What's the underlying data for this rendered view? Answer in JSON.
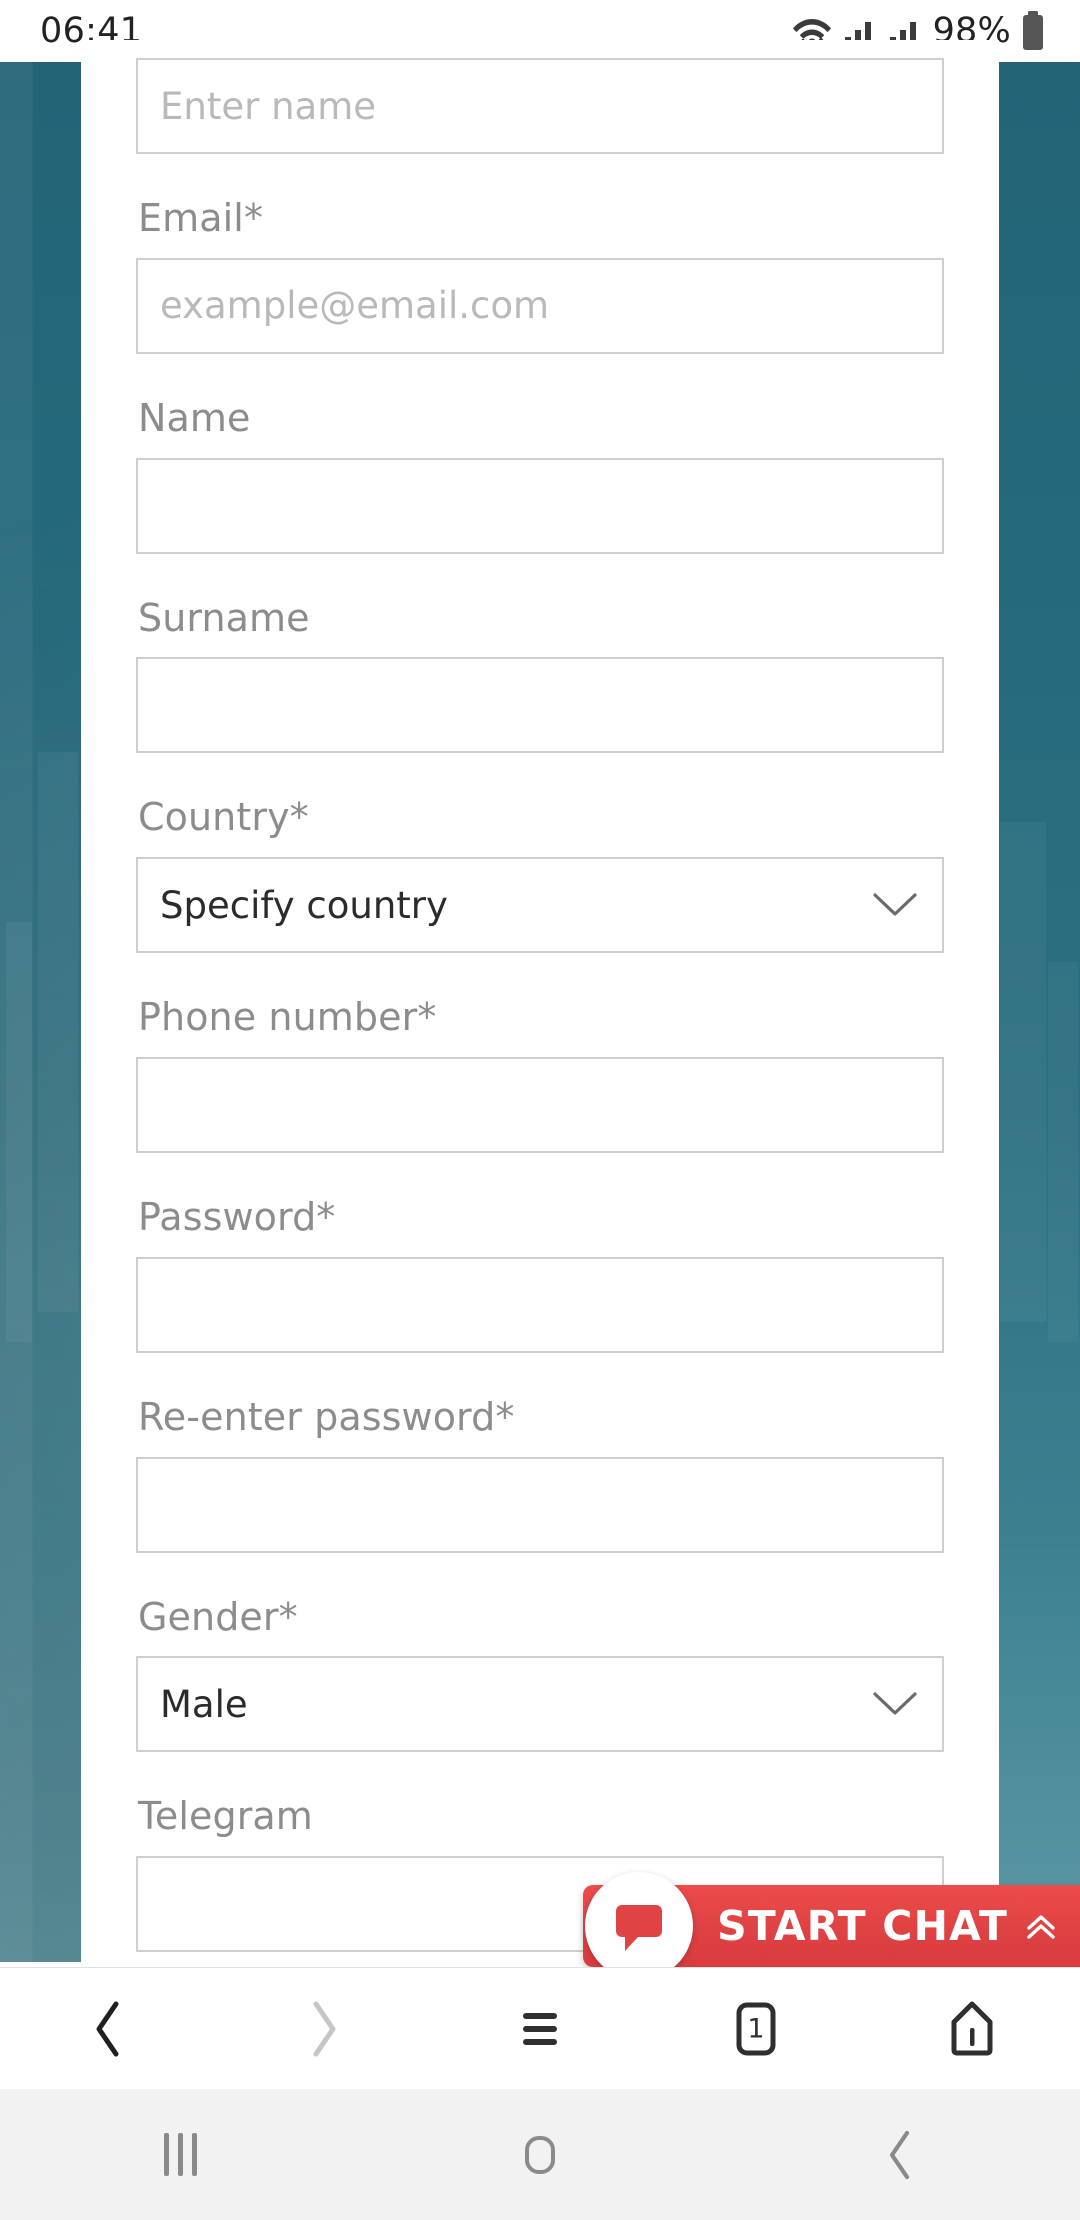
{
  "status_bar": {
    "clock": "06:41",
    "battery_percent": "98%",
    "icons": [
      "wifi-icon",
      "signal-icon",
      "signal-icon",
      "battery-icon"
    ]
  },
  "form": {
    "fields": [
      {
        "label": "",
        "required": false,
        "type": "text",
        "value": "",
        "placeholder": "Enter name",
        "name": "name-top"
      },
      {
        "label": "Email",
        "required": true,
        "type": "text",
        "value": "",
        "placeholder": "example@email.com",
        "name": "email"
      },
      {
        "label": "Name",
        "required": false,
        "type": "text",
        "value": "",
        "placeholder": "",
        "name": "first-name"
      },
      {
        "label": "Surname",
        "required": false,
        "type": "text",
        "value": "",
        "placeholder": "",
        "name": "surname"
      },
      {
        "label": "Country",
        "required": true,
        "type": "select",
        "value": "Specify country",
        "placeholder": "",
        "name": "country"
      },
      {
        "label": "Phone number",
        "required": true,
        "type": "text",
        "value": "",
        "placeholder": "",
        "name": "phone-number"
      },
      {
        "label": "Password",
        "required": true,
        "type": "text",
        "value": "",
        "placeholder": "",
        "name": "password"
      },
      {
        "label": "Re-enter password",
        "required": true,
        "type": "text",
        "value": "",
        "placeholder": "",
        "name": "re-enter-password"
      },
      {
        "label": "Gender",
        "required": true,
        "type": "select",
        "value": "Male",
        "placeholder": "",
        "name": "gender"
      },
      {
        "label": "Telegram",
        "required": false,
        "type": "text",
        "value": "",
        "placeholder": "",
        "name": "telegram"
      }
    ],
    "required_marker": "*"
  },
  "chat_widget": {
    "label": "START CHAT",
    "bubble_icon": "chat-bubble-icon",
    "expand_icon": "chevron-up-double-icon",
    "accent_color": "#e04343"
  },
  "browser_toolbar": {
    "items": [
      {
        "name": "back-button",
        "icon": "chevron-left-icon",
        "enabled": true
      },
      {
        "name": "forward-button",
        "icon": "chevron-right-icon",
        "enabled": false
      },
      {
        "name": "menu-button",
        "icon": "hamburger-icon",
        "enabled": true
      },
      {
        "name": "tabs-button",
        "icon": "tab-counter-icon",
        "count": "1",
        "enabled": true
      },
      {
        "name": "home-button",
        "icon": "home-icon",
        "enabled": true
      }
    ]
  },
  "system_nav": {
    "items": [
      {
        "name": "recents-button",
        "icon": "recents-icon"
      },
      {
        "name": "home-button",
        "icon": "home-circle-icon"
      },
      {
        "name": "back-button",
        "icon": "chevron-left-icon"
      }
    ]
  },
  "colors": {
    "page_background": "#2b6e80",
    "card_background": "#ffffff",
    "label_text": "#8c8c8c",
    "input_border": "#cfcfcf",
    "placeholder_text": "#b9b9b9",
    "value_text": "#2b2b2b",
    "chat_red": "#e04343"
  }
}
